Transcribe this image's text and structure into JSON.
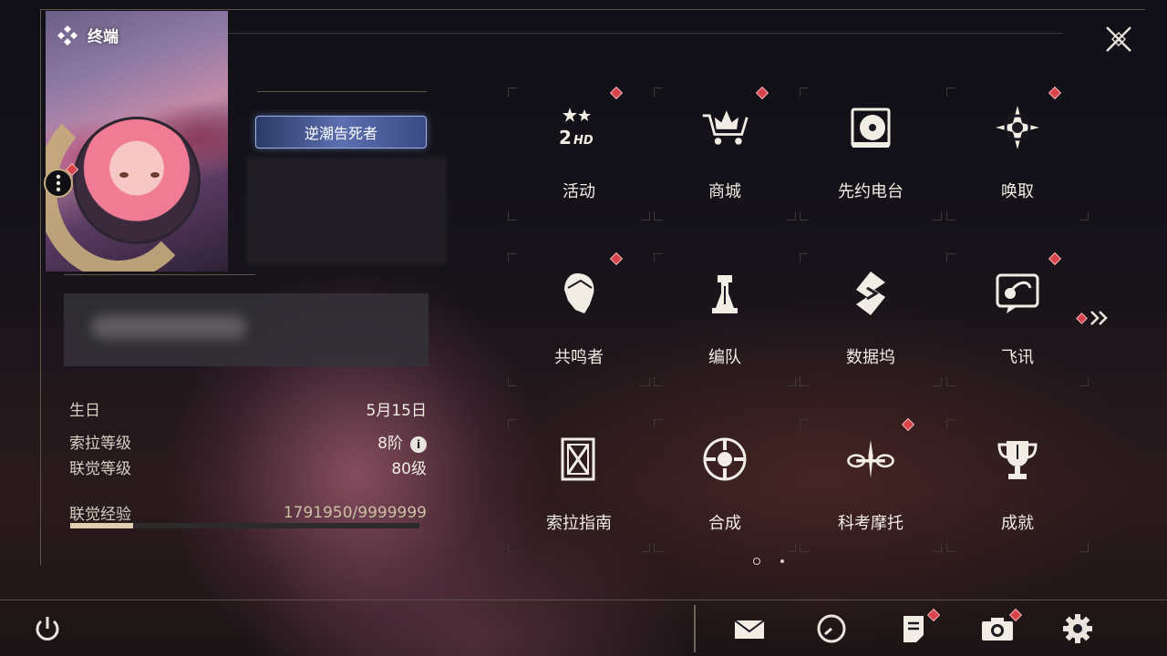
{
  "header": {
    "title": "终端",
    "player_title_badge": "逆潮告死者"
  },
  "profile": {
    "stats": [
      {
        "label": "生日",
        "value": "5月15日"
      },
      {
        "label": "索拉等级",
        "value": "8阶"
      },
      {
        "label": "联觉等级",
        "value": "80级"
      }
    ],
    "experience": {
      "label": "联觉经验",
      "value": "1791950/9999999",
      "progress": 0.179
    }
  },
  "grid": {
    "items": [
      {
        "label": "活动",
        "icon": "event-2hd-icon",
        "badge": true
      },
      {
        "label": "商城",
        "icon": "shop-crown-cart-icon",
        "badge": true
      },
      {
        "label": "先约电台",
        "icon": "radio-record-icon",
        "badge": false
      },
      {
        "label": "唤取",
        "icon": "compass-star-icon",
        "badge": true
      },
      {
        "label": "共鸣者",
        "icon": "resonator-head-icon",
        "badge": true
      },
      {
        "label": "编队",
        "icon": "chess-team-icon",
        "badge": false
      },
      {
        "label": "数据坞",
        "icon": "data-dock-icon",
        "badge": false
      },
      {
        "label": "飞讯",
        "icon": "chat-message-icon",
        "badge": true
      },
      {
        "label": "索拉指南",
        "icon": "guide-book-icon",
        "badge": false
      },
      {
        "label": "合成",
        "icon": "synthesis-circle-icon",
        "badge": false
      },
      {
        "label": "科考摩托",
        "icon": "motorcycle-icon",
        "badge": true
      },
      {
        "label": "成就",
        "icon": "trophy-icon",
        "badge": false
      }
    ],
    "page_count": 2,
    "current_page": 1
  },
  "bottom_bar": {
    "items": [
      "power-icon",
      "mail-icon",
      "clock-icon",
      "notes-icon",
      "camera-icon",
      "settings-gear-icon"
    ]
  },
  "colors": {
    "accent_gold": "#c7ad7d",
    "badge_red": "#d8424a",
    "text": "#f0ebe3"
  }
}
